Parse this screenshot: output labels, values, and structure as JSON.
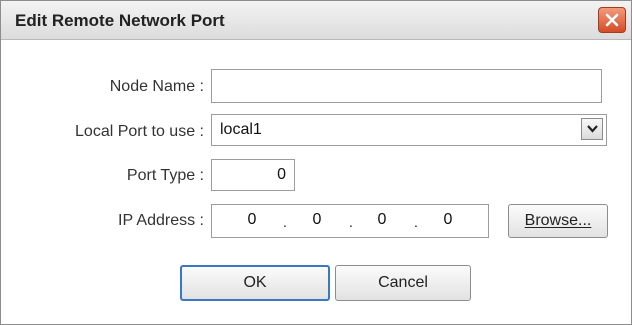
{
  "window": {
    "title": "Edit Remote Network Port"
  },
  "form": {
    "node_name": {
      "label": "Node Name :",
      "value": ""
    },
    "local_port": {
      "label": "Local Port to use :",
      "value": "local1"
    },
    "port_type": {
      "label": "Port Type :",
      "value": "0"
    },
    "ip_address": {
      "label": "IP Address :",
      "octets": [
        "0",
        "0",
        "0",
        "0"
      ]
    }
  },
  "buttons": {
    "browse": "Browse...",
    "ok": "OK",
    "cancel": "Cancel"
  },
  "icons": {
    "close": "close-icon",
    "dropdown": "chevron-down-icon"
  }
}
